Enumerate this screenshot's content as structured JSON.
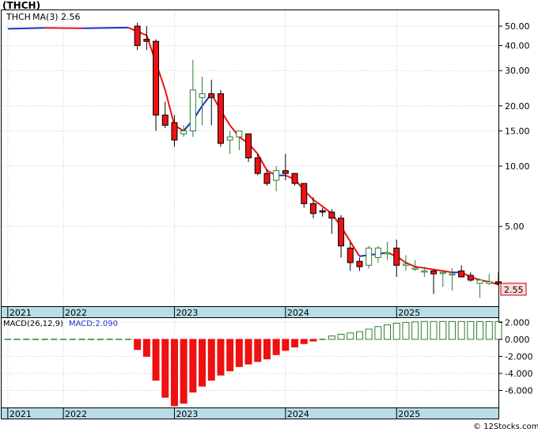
{
  "ticker_title": "(THCH)",
  "legend": {
    "ticker": "THCH",
    "ma_label": "MA(3)",
    "ma_value": "2.56"
  },
  "last_price_tag": "2.55",
  "macd": {
    "label": "MACD(26,12,9)",
    "value_label": "MACD:2.090"
  },
  "watermark": "© 12Stocks.com",
  "colors": {
    "up_candle_stroke": "#2e7d32",
    "down_candle_fill": "#ee1111",
    "ma_up": "#1a33cc",
    "ma_down": "#ee1111",
    "macd_positive": "#2e7d32",
    "macd_negative": "#ee1111",
    "year_band": "#b8dde8",
    "price_tag": "#ffd9d9"
  },
  "chart_data": [
    {
      "type": "candlestick",
      "title": "(THCH)",
      "y_scale": "log",
      "y_ticks": [
        50,
        40,
        30,
        20,
        15,
        10,
        5
      ],
      "y_tick_labels": [
        "50.00",
        "40.00",
        "30.00",
        "20.00",
        "15.00",
        "10.00",
        "5.00"
      ],
      "x_year_labels": [
        "2021",
        "2022",
        "2023",
        "2024",
        "2025"
      ],
      "x_year_positions": [
        -0.5,
        5.5,
        17.5,
        29.5,
        41.5
      ],
      "candles": [
        {
          "i": 14,
          "o": 50,
          "h": 52,
          "l": 38,
          "c": 40
        },
        {
          "i": 15,
          "o": 43,
          "h": 50,
          "l": 38,
          "c": 42
        },
        {
          "i": 16,
          "o": 42,
          "h": 43,
          "l": 15,
          "c": 18
        },
        {
          "i": 17,
          "o": 18,
          "h": 21,
          "l": 15.5,
          "c": 16
        },
        {
          "i": 18,
          "o": 16.5,
          "h": 18,
          "l": 12.5,
          "c": 13.5
        },
        {
          "i": 19,
          "o": 14.5,
          "h": 16,
          "l": 14,
          "c": 15
        },
        {
          "i": 20,
          "o": 15,
          "h": 34,
          "l": 14,
          "c": 24
        },
        {
          "i": 21,
          "o": 22,
          "h": 28,
          "l": 16,
          "c": 23
        },
        {
          "i": 22,
          "o": 23,
          "h": 27,
          "l": 16,
          "c": 22
        },
        {
          "i": 23,
          "o": 23,
          "h": 24,
          "l": 12.5,
          "c": 13
        },
        {
          "i": 24,
          "o": 13.5,
          "h": 15,
          "l": 11.5,
          "c": 14
        },
        {
          "i": 25,
          "o": 14,
          "h": 15,
          "l": 12,
          "c": 15
        },
        {
          "i": 26,
          "o": 14.5,
          "h": 14.5,
          "l": 10.5,
          "c": 11
        },
        {
          "i": 27,
          "o": 11,
          "h": 11.5,
          "l": 9,
          "c": 9.2
        },
        {
          "i": 28,
          "o": 9.2,
          "h": 9.6,
          "l": 8,
          "c": 8.2
        },
        {
          "i": 29,
          "o": 8.5,
          "h": 10,
          "l": 7.5,
          "c": 9.5
        },
        {
          "i": 30,
          "o": 9.5,
          "h": 11.5,
          "l": 8.5,
          "c": 9.2
        },
        {
          "i": 31,
          "o": 9.2,
          "h": 9.2,
          "l": 8,
          "c": 8.2
        },
        {
          "i": 32,
          "o": 8.2,
          "h": 8.2,
          "l": 6.2,
          "c": 6.5
        },
        {
          "i": 33,
          "o": 6.5,
          "h": 7,
          "l": 5.5,
          "c": 5.8
        },
        {
          "i": 34,
          "o": 6,
          "h": 6.2,
          "l": 5.6,
          "c": 5.9
        },
        {
          "i": 35,
          "o": 5.9,
          "h": 6.1,
          "l": 4.6,
          "c": 5.5
        },
        {
          "i": 36,
          "o": 5.5,
          "h": 5.7,
          "l": 3.5,
          "c": 4.0
        },
        {
          "i": 37,
          "o": 3.9,
          "h": 4.2,
          "l": 3.0,
          "c": 3.3
        },
        {
          "i": 38,
          "o": 3.35,
          "h": 3.5,
          "l": 3.0,
          "c": 3.15
        },
        {
          "i": 39,
          "o": 3.2,
          "h": 4.0,
          "l": 3.1,
          "c": 3.9
        },
        {
          "i": 40,
          "o": 3.5,
          "h": 4.0,
          "l": 3.3,
          "c": 3.9
        },
        {
          "i": 41,
          "o": 3.7,
          "h": 4.2,
          "l": 3.4,
          "c": 3.7
        },
        {
          "i": 42,
          "o": 3.9,
          "h": 4.3,
          "l": 2.8,
          "c": 3.2
        },
        {
          "i": 43,
          "o": 3.2,
          "h": 3.6,
          "l": 3.0,
          "c": 3.25
        },
        {
          "i": 44,
          "o": 3.1,
          "h": 3.4,
          "l": 3.0,
          "c": 3.1
        },
        {
          "i": 45,
          "o": 3.0,
          "h": 3.15,
          "l": 2.8,
          "c": 3.0
        },
        {
          "i": 46,
          "o": 3.0,
          "h": 3.05,
          "l": 2.3,
          "c": 2.9
        },
        {
          "i": 47,
          "o": 2.95,
          "h": 3.0,
          "l": 2.5,
          "c": 2.95
        },
        {
          "i": 48,
          "o": 2.9,
          "h": 3.1,
          "l": 2.4,
          "c": 2.9
        },
        {
          "i": 49,
          "o": 3.0,
          "h": 3.2,
          "l": 2.8,
          "c": 2.8
        },
        {
          "i": 50,
          "o": 2.85,
          "h": 2.95,
          "l": 2.65,
          "c": 2.7
        },
        {
          "i": 51,
          "o": 2.6,
          "h": 2.75,
          "l": 2.2,
          "c": 2.7
        },
        {
          "i": 52,
          "o": 2.6,
          "h": 2.9,
          "l": 2.55,
          "c": 2.65
        },
        {
          "i": 53,
          "o": 2.65,
          "h": 2.95,
          "l": 2.55,
          "c": 2.6
        }
      ],
      "ma": [
        {
          "i": 0,
          "v": 48.5
        },
        {
          "i": 4,
          "v": 49.0
        },
        {
          "i": 8,
          "v": 48.8
        },
        {
          "i": 13,
          "v": 49.2
        },
        {
          "i": 14,
          "v": 47
        },
        {
          "i": 15,
          "v": 45
        },
        {
          "i": 16,
          "v": 33
        },
        {
          "i": 17,
          "v": 24
        },
        {
          "i": 18,
          "v": 16
        },
        {
          "i": 19,
          "v": 15
        },
        {
          "i": 20,
          "v": 17
        },
        {
          "i": 21,
          "v": 20
        },
        {
          "i": 22,
          "v": 23
        },
        {
          "i": 23,
          "v": 19
        },
        {
          "i": 24,
          "v": 16
        },
        {
          "i": 25,
          "v": 14
        },
        {
          "i": 26,
          "v": 13
        },
        {
          "i": 27,
          "v": 11.5
        },
        {
          "i": 28,
          "v": 9.5
        },
        {
          "i": 29,
          "v": 9.0
        },
        {
          "i": 30,
          "v": 9.0
        },
        {
          "i": 31,
          "v": 8.6
        },
        {
          "i": 32,
          "v": 7.6
        },
        {
          "i": 33,
          "v": 6.8
        },
        {
          "i": 34,
          "v": 6.3
        },
        {
          "i": 35,
          "v": 5.8
        },
        {
          "i": 36,
          "v": 5.0
        },
        {
          "i": 37,
          "v": 4.2
        },
        {
          "i": 38,
          "v": 3.55
        },
        {
          "i": 39,
          "v": 3.6
        },
        {
          "i": 40,
          "v": 3.65
        },
        {
          "i": 41,
          "v": 3.7
        },
        {
          "i": 42,
          "v": 3.55
        },
        {
          "i": 43,
          "v": 3.3
        },
        {
          "i": 44,
          "v": 3.15
        },
        {
          "i": 45,
          "v": 3.1
        },
        {
          "i": 46,
          "v": 3.05
        },
        {
          "i": 47,
          "v": 3.0
        },
        {
          "i": 48,
          "v": 2.95
        },
        {
          "i": 49,
          "v": 2.95
        },
        {
          "i": 50,
          "v": 2.8
        },
        {
          "i": 51,
          "v": 2.7
        },
        {
          "i": 52,
          "v": 2.65
        },
        {
          "i": 53,
          "v": 2.56
        }
      ]
    },
    {
      "type": "bar",
      "title": "MACD(26,12,9)",
      "y_ticks": [
        2,
        0,
        -2,
        -4,
        -6
      ],
      "y_tick_labels": [
        "2.000",
        "0.000",
        "-2.000",
        "-4.000",
        "-6.000"
      ],
      "ylim": [
        -8,
        2.5
      ],
      "x_year_labels": [
        "2021",
        "2022",
        "2023",
        "2024",
        "2025"
      ],
      "values": [
        0,
        0,
        0,
        0.05,
        0.08,
        0.08,
        0.08,
        0.07,
        0.06,
        0.05,
        0.04,
        0.03,
        0.02,
        0.01,
        -1.2,
        -2.0,
        -4.8,
        -6.8,
        -7.8,
        -7.5,
        -6.2,
        -5.5,
        -4.8,
        -4.2,
        -3.7,
        -3.2,
        -2.9,
        -2.6,
        -2.3,
        -1.8,
        -1.3,
        -0.9,
        -0.5,
        -0.2,
        0.15,
        0.4,
        0.6,
        0.75,
        0.9,
        1.2,
        1.5,
        1.7,
        1.9,
        2.0,
        2.05,
        2.1,
        2.1,
        2.1,
        2.1,
        2.1,
        2.09,
        2.09,
        2.09,
        2.09
      ]
    }
  ]
}
